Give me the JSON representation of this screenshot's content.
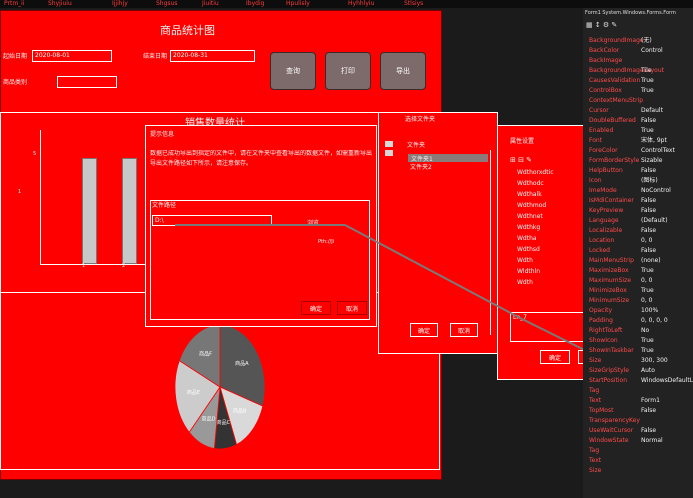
{
  "menubar": {
    "items": [
      "Prtm_ii",
      "Shyjiuiu",
      "Ijjihjy",
      "Shgsus",
      "Jiuitiu",
      "Ibydig",
      "Hpulisly",
      "Hyhhlyiu",
      "Stlsiys"
    ]
  },
  "main_window": {
    "title": "商品统计图",
    "from_label": "起始日期",
    "from_value": "2020-08-01",
    "to_label": "结束日期",
    "to_value": "2020-08-31",
    "category_label": "商品类别",
    "category_value": "",
    "btn_query": "查询",
    "btn_print": "打印",
    "btn_export": "导出"
  },
  "bar_chart": {
    "title": "销售数量统计",
    "axis_ticks_y": [
      "5",
      "1",
      "0"
    ],
    "axis_ticks_x": [
      "1",
      "2"
    ]
  },
  "chart_data": {
    "type": "pie",
    "slices": [
      {
        "label": "商品A",
        "value": 30,
        "color": "#555555"
      },
      {
        "label": "商品B",
        "value": 14,
        "color": "#d9d9d9"
      },
      {
        "label": "商品C",
        "value": 8,
        "color": "#333333"
      },
      {
        "label": "商品D",
        "value": 10,
        "color": "#999999"
      },
      {
        "label": "商品E",
        "value": 20,
        "color": "#cccccc"
      },
      {
        "label": "商品F",
        "value": 18,
        "color": "#777777"
      }
    ]
  },
  "msg_dialog": {
    "title": "提示信息",
    "line1": "数据已成功导出到指定的文件中，请在文件夹中查看导出的数据文件，如需重新导出请再次点击。",
    "line2": "导出文件路径如下所示，请注意保存。",
    "path_label": "文件路径",
    "path_value": "D:\\",
    "browse_btn": "浏览...",
    "ok_btn": "确定",
    "cancel_btn": "取消",
    "link_text": "Pth://Ji"
  },
  "tree_dialog": {
    "title": "选择文件夹",
    "items": [
      "文件夹",
      "文件夹1",
      "文件夹2"
    ],
    "ok_btn": "确定",
    "cancel_btn": "取消"
  },
  "settings_dialog": {
    "title": "属性设置",
    "rows": [
      "Wdthorxdtic",
      "Wdthodc",
      "Wdthalk",
      "Wdthmod",
      "Wdthnet",
      "Wdthkg",
      "Wdtha",
      "Wdthsd",
      "Wdth",
      "Wldthln",
      "Wdth"
    ],
    "bottom_text": "Ln_7",
    "ok_btn": "确定",
    "cancel_btn": "取消"
  },
  "properties": {
    "title": "Form1 System.Windows.Forms.Form",
    "rows": [
      [
        "BackgroundImage",
        "(无)"
      ],
      [
        "BackColor",
        "Control"
      ],
      [
        "BackImage",
        ""
      ],
      [
        "BackgroundImageLayout",
        "Tile"
      ],
      [
        "CausesValidation",
        "True"
      ],
      [
        "ControlBox",
        "True"
      ],
      [
        "ContextMenuStrip",
        ""
      ],
      [
        "Cursor",
        "Default"
      ],
      [
        "DoubleBuffered",
        "False"
      ],
      [
        "Enabled",
        "True"
      ],
      [
        "Font",
        "宋体, 9pt"
      ],
      [
        "ForeColor",
        "ControlText"
      ],
      [
        "FormBorderStyle",
        "Sizable"
      ],
      [
        "HelpButton",
        "False"
      ],
      [
        "Icon",
        "(图标)"
      ],
      [
        "ImeMode",
        "NoControl"
      ],
      [
        "IsMdiContainer",
        "False"
      ],
      [
        "KeyPreview",
        "False"
      ],
      [
        "Language",
        "(Default)"
      ],
      [
        "Localizable",
        "False"
      ],
      [
        "Location",
        "0, 0"
      ],
      [
        "Locked",
        "False"
      ],
      [
        "MainMenuStrip",
        "(none)"
      ],
      [
        "MaximizeBox",
        "True"
      ],
      [
        "MaximumSize",
        "0, 0"
      ],
      [
        "MinimizeBox",
        "True"
      ],
      [
        "MinimumSize",
        "0, 0"
      ],
      [
        "Opacity",
        "100%"
      ],
      [
        "Padding",
        "0, 0, 0, 0"
      ],
      [
        "RightToLeft",
        "No"
      ],
      [
        "ShowIcon",
        "True"
      ],
      [
        "ShowInTaskbar",
        "True"
      ],
      [
        "Size",
        "300, 300"
      ],
      [
        "SizeGripStyle",
        "Auto"
      ],
      [
        "StartPosition",
        "WindowsDefaultLocation"
      ],
      [
        "Tag",
        ""
      ],
      [
        "Text",
        "Form1"
      ],
      [
        "TopMost",
        "False"
      ],
      [
        "TransparencyKey",
        ""
      ],
      [
        "UseWaitCursor",
        "False"
      ],
      [
        "WindowState",
        "Normal"
      ],
      [
        "Tag",
        ""
      ],
      [
        "Text",
        ""
      ],
      [
        "Size",
        ""
      ]
    ]
  }
}
